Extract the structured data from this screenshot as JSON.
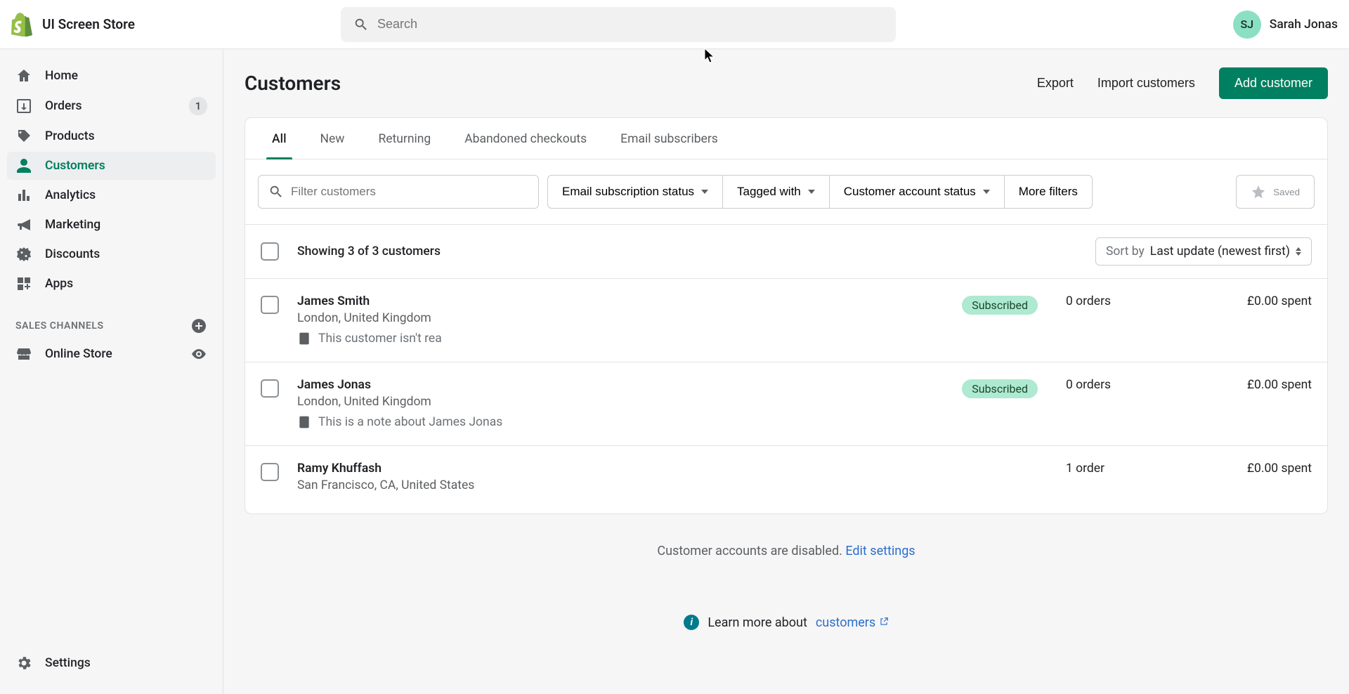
{
  "header": {
    "store_name": "UI Screen Store",
    "search_placeholder": "Search",
    "user_initials": "SJ",
    "user_name": "Sarah Jonas"
  },
  "sidebar": {
    "items": [
      {
        "label": "Home"
      },
      {
        "label": "Orders",
        "badge": "1"
      },
      {
        "label": "Products"
      },
      {
        "label": "Customers",
        "active": true
      },
      {
        "label": "Analytics"
      },
      {
        "label": "Marketing"
      },
      {
        "label": "Discounts"
      },
      {
        "label": "Apps"
      }
    ],
    "channels_heading": "SALES CHANNELS",
    "channels": [
      {
        "label": "Online Store"
      }
    ],
    "settings_label": "Settings"
  },
  "page": {
    "title": "Customers",
    "export_label": "Export",
    "import_label": "Import customers",
    "add_label": "Add customer"
  },
  "tabs": [
    "All",
    "New",
    "Returning",
    "Abandoned checkouts",
    "Email subscribers"
  ],
  "filters": {
    "placeholder": "Filter customers",
    "email_sub": "Email subscription status",
    "tagged": "Tagged with",
    "account_status": "Customer account status",
    "more": "More filters",
    "saved": "Saved"
  },
  "list": {
    "showing": "Showing 3 of 3 customers",
    "sort_label": "Sort by",
    "sort_value": "Last update (newest first)"
  },
  "customers": [
    {
      "name": "James Smith",
      "location": "London, United Kingdom",
      "note": "This customer isn't rea",
      "status": "Subscribed",
      "orders": "0 orders",
      "spent": "£0.00 spent"
    },
    {
      "name": "James Jonas",
      "location": "London, United Kingdom",
      "note": "This is a note about James Jonas",
      "status": "Subscribed",
      "orders": "0 orders",
      "spent": "£0.00 spent"
    },
    {
      "name": "Ramy Khuffash",
      "location": "San Francisco, CA, United States",
      "note": "",
      "status": "",
      "orders": "1 order",
      "spent": "£0.00 spent"
    }
  ],
  "footer": {
    "disabled_text": "Customer accounts are disabled. ",
    "edit_link": "Edit settings",
    "learn_text": "Learn more about ",
    "learn_link": "customers"
  }
}
